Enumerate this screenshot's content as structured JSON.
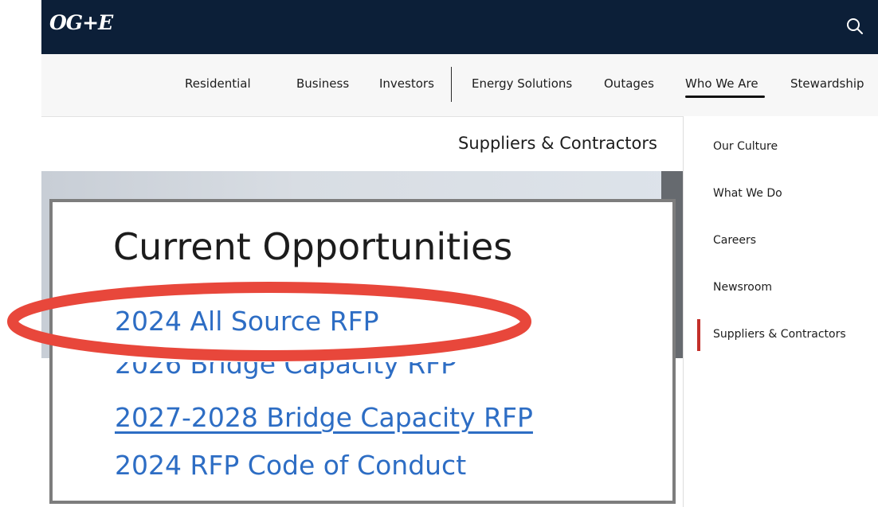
{
  "header": {
    "logo_text": "OG+E",
    "search_icon": "search-icon",
    "background_color": "#0c1f38"
  },
  "nav": {
    "items": [
      {
        "label": "Residential"
      },
      {
        "label": "Business"
      },
      {
        "label": "Investors"
      },
      {
        "label": "Energy Solutions"
      },
      {
        "label": "Outages"
      },
      {
        "label": "Who We Are"
      },
      {
        "label": "Stewardship"
      }
    ],
    "active": "Who We Are"
  },
  "page": {
    "heading": "Suppliers & Contractors"
  },
  "opportunities": {
    "title": "Current Opportunities",
    "links": [
      {
        "label": "2024 All Source RFP"
      },
      {
        "label": "2026 Bridge Capacity RFP"
      },
      {
        "label": "2027-2028 Bridge Capacity RFP"
      },
      {
        "label": "2024 RFP Code of Conduct"
      }
    ],
    "link_color": "#2d6dc4"
  },
  "dropdown": {
    "items": [
      {
        "label": "Our Culture"
      },
      {
        "label": "What We Do"
      },
      {
        "label": "Careers"
      },
      {
        "label": "Newsroom"
      },
      {
        "label": "Suppliers & Contractors"
      }
    ],
    "active": "Suppliers & Contractors",
    "active_color": "#c3302a"
  },
  "annotation": {
    "color": "#e8473b"
  }
}
